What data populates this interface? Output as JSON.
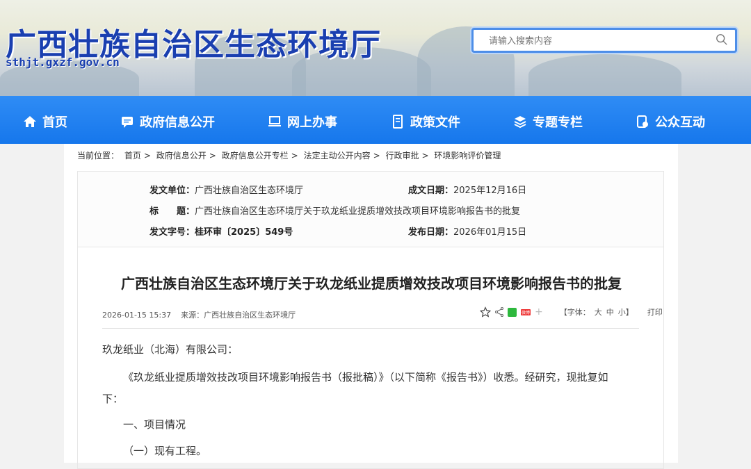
{
  "header": {
    "site_name": "广西壮族自治区生态环境厅",
    "url": "sthjt.gxzf.gov.cn",
    "search_placeholder": "请输入搜索内容"
  },
  "nav": [
    {
      "label": "首页",
      "icon": "home-icon"
    },
    {
      "label": "政府信息公开",
      "icon": "info-icon"
    },
    {
      "label": "网上办事",
      "icon": "laptop-icon"
    },
    {
      "label": "政策文件",
      "icon": "document-icon"
    },
    {
      "label": "专题专栏",
      "icon": "layers-icon"
    },
    {
      "label": "公众互动",
      "icon": "chat-icon"
    }
  ],
  "breadcrumb": {
    "label": "当前位置：",
    "items": [
      "首页",
      "政府信息公开",
      "政府信息公开专栏",
      "法定主动公开内容",
      "行政审批",
      "环境影响评价管理"
    ],
    "sep": ">"
  },
  "meta": {
    "issuer_label": "发文单位：",
    "issuer": "广西壮族自治区生态环境厅",
    "created_label": "成文日期：",
    "created": "2025年12月16日",
    "title_label": "标　　题：",
    "title": "广西壮族自治区生态环境厅关于玖龙纸业提质增效技改项目环境影响报告书的批复",
    "number_label": "发文字号：",
    "number": "桂环审〔2025〕549号",
    "published_label": "发布日期：",
    "published": "2026年01月15日"
  },
  "article": {
    "title": "广西壮族自治区生态环境厅关于玖龙纸业提质增效技改项目环境影响报告书的批复",
    "datetime": "2026-01-15 15:37",
    "source_label": "来源：",
    "source": "广西壮族自治区生态环境厅",
    "font_label": "【字体：",
    "font_large": "大",
    "font_medium": "中",
    "font_small": "小】",
    "print": "打印",
    "weibo_badge": "微博",
    "paragraphs": [
      "玖龙纸业（北海）有限公司：",
      "《玖龙纸业提质增效技改项目环境影响报告书（报批稿）》（以下简称《报告书》）收悉。经研究，现批复如",
      "下：",
      "一、项目情况",
      "（一）现有工程。"
    ]
  }
}
